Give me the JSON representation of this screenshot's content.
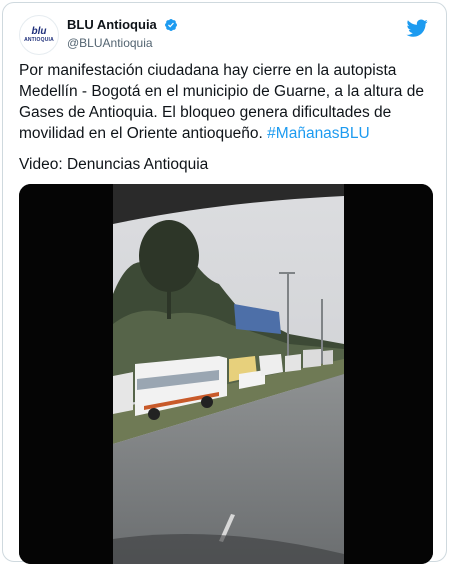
{
  "tweet": {
    "account": {
      "display_name": "BLU Antioquia",
      "handle": "@BLUAntioquia",
      "avatar_line1": "blu",
      "avatar_line2": "ANTIOQUIA",
      "verified_icon": "verified-badge-icon",
      "platform_icon": "twitter-bird-icon"
    },
    "text": "Por manifestación ciudadana hay cierre en la  autopista Medellín - Bogotá en el municipio de Guarne, a la altura de Gases de Antioquia. El bloqueo genera dificultades de movilidad en el Oriente antioqueño. ",
    "hashtag": "#MañanasBLU",
    "source_line": "Video: Denuncias Antioquia",
    "media": {
      "type": "video",
      "description_icon": "video-frame"
    }
  },
  "colors": {
    "link_blue": "#1d9bf0",
    "verified_blue": "#1d9bf0",
    "text": "#0f1419",
    "secondary_text": "#536471",
    "border": "#cfd9de"
  }
}
